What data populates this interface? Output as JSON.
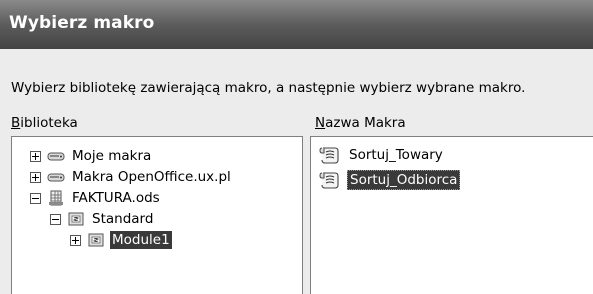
{
  "dialog": {
    "title": "Wybierz makro",
    "instruction": "Wybierz bibliotekę zawierającą makro, a następnie wybierz wybrane makro.",
    "library_label_first": "B",
    "library_label_rest": "iblioteka",
    "macro_label_first": "N",
    "macro_label_rest": "azwa Makra"
  },
  "tree": [
    {
      "label": "Moje makra",
      "icon": "drive-icon",
      "expander": "plus"
    },
    {
      "label": "Makra OpenOffice.ux.pl",
      "icon": "drive-icon",
      "expander": "plus"
    },
    {
      "label": "FAKTURA.ods",
      "icon": "spreadsheet-icon",
      "expander": "minus"
    },
    {
      "label": "Standard",
      "icon": "library-icon",
      "expander": "minus"
    },
    {
      "label": "Module1",
      "icon": "module-icon",
      "expander": "plus",
      "selected": true
    }
  ],
  "macros": [
    {
      "label": "Sortuj_Towary",
      "icon": "macro-icon"
    },
    {
      "label": "Sortuj_Odbiorca",
      "icon": "macro-icon",
      "selected": true
    }
  ]
}
